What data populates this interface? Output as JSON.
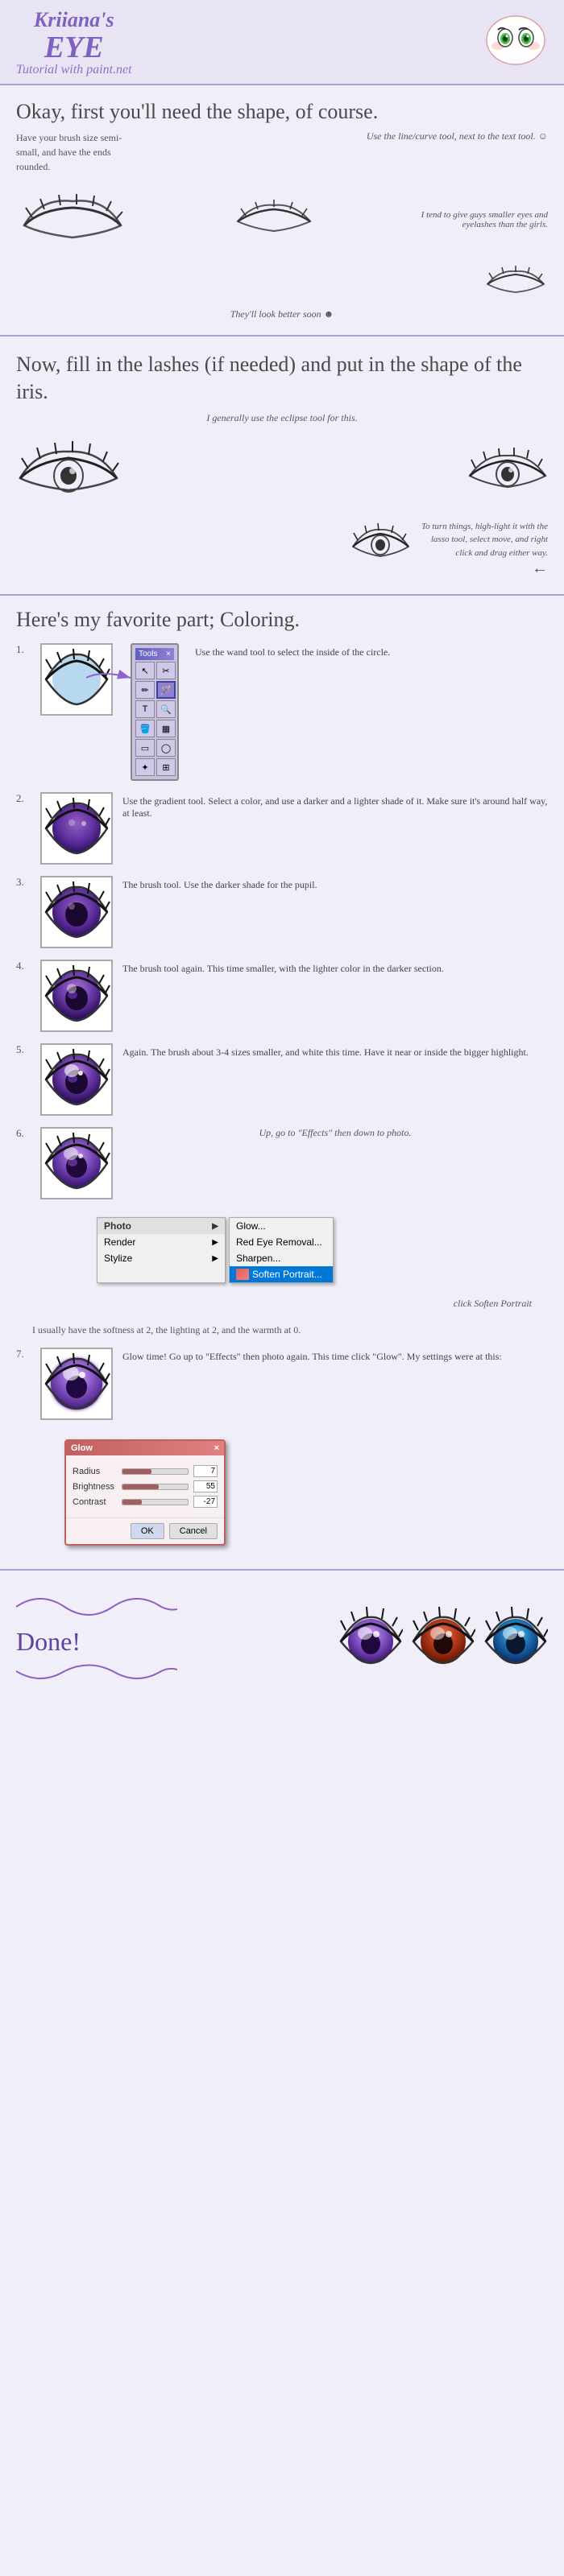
{
  "header": {
    "kriiana": "Kriiana's",
    "eye": "EYE",
    "subtitle": "Tutorial with paint.net"
  },
  "section1": {
    "title": "Okay, first you'll need the shape, of course.",
    "note1": "Use the line/curve tool, next to the text tool. ☺",
    "note2": "Have your brush size semi-small, and have the ends rounded.",
    "note3": "I tend to give guys smaller eyes and eyelashes than the girls.",
    "note4": "They'll look better soon ☻"
  },
  "section2": {
    "title": "Now, fill in the lashes (if needed) and put in the shape of the iris.",
    "note1": "I generally use the eclipse tool for this.",
    "note2": "To turn things, high-light it with the lasso tool, select move, and right click and drag either way."
  },
  "section3": {
    "title": "Here's my favorite part; Coloring.",
    "steps": [
      {
        "number": "1.",
        "text": "Use the wand tool to select the inside of the circle."
      },
      {
        "number": "2.",
        "text": "Use the gradient tool. Select a color, and use a darker and a lighter shade of it. Make sure it's around half way, at least."
      },
      {
        "number": "3.",
        "text": "The brush tool. Use the darker shade for the pupil."
      },
      {
        "number": "4.",
        "text": "The brush tool again. This time smaller, with the lighter color in the darker section."
      },
      {
        "number": "5.",
        "text": "Again. The brush about 3-4 sizes smaller, and white this time. Have it near or inside the bigger highlight."
      },
      {
        "number": "6.",
        "text": "Up, go to \"Effects\" then down to photo.",
        "subtext": "and click Soften Portrait",
        "note": "I usually have the softness at 2, the lighting at 2, and the warmth at 0."
      },
      {
        "number": "7.",
        "text": "Glow time! Go up to \"Effects\" then photo again. This time click \"Glow\". My settings were at this:"
      }
    ]
  },
  "tools": {
    "title": "Tools",
    "close": "×",
    "items": [
      "↖",
      "✂",
      "✏",
      "⬡",
      "T",
      "🔍",
      "🪣",
      "⟲",
      "▭",
      "◯",
      "✦",
      "🔧"
    ]
  },
  "menu": {
    "label_effects": "Effects",
    "items": [
      {
        "label": "Photo",
        "hasArrow": true
      },
      {
        "label": "Render",
        "hasArrow": true
      },
      {
        "label": "Stylize",
        "hasArrow": true
      }
    ],
    "submenu": [
      {
        "label": "Glow..."
      },
      {
        "label": "Red Eye Removal..."
      },
      {
        "label": "Sharpen..."
      },
      {
        "label": "Soften Portrait...",
        "highlighted": true
      }
    ]
  },
  "glow_dialog": {
    "title": "Glow",
    "close": "×",
    "fields": [
      {
        "label": "Radius",
        "value": "7",
        "fill_pct": 45
      },
      {
        "label": "Brightness",
        "value": "55",
        "fill_pct": 55
      },
      {
        "label": "Contrast",
        "value": "-27",
        "fill_pct": 30
      }
    ],
    "ok_label": "OK",
    "cancel_label": "Cancel"
  },
  "done": {
    "label": "Done!"
  },
  "soften_click_label": "click Soften Portrait"
}
